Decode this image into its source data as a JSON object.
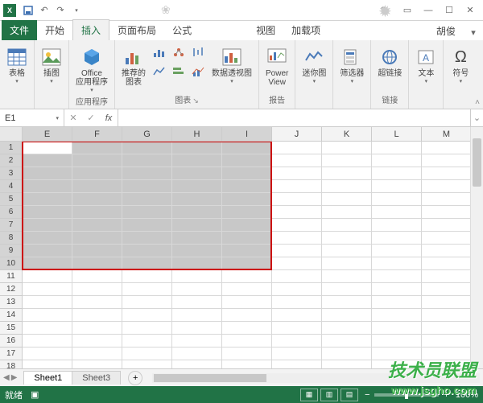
{
  "title_bar": {
    "qat": [
      "save",
      "undo",
      "redo"
    ]
  },
  "tabs": {
    "file": "文件",
    "items": [
      "开始",
      "插入",
      "页面布局",
      "公式",
      "视图",
      "加载项"
    ],
    "active_index": 1,
    "user": "胡俊"
  },
  "ribbon": {
    "groups": {
      "tables": {
        "btn": "表格",
        "label": ""
      },
      "illustrations": {
        "btn": "插图",
        "label": ""
      },
      "apps": {
        "btn": "Office\n应用程序",
        "label": "应用程序"
      },
      "charts": {
        "btn": "推荐的\n图表",
        "pivot": "数据透视图",
        "label": "图表"
      },
      "reports": {
        "btn": "Power\nView",
        "label": "报告"
      },
      "sparklines": {
        "btn": "迷你图",
        "label": ""
      },
      "filters": {
        "btn": "筛选器",
        "label": ""
      },
      "links": {
        "btn": "超链接",
        "label": "链接"
      },
      "text": {
        "btn": "文本",
        "label": ""
      },
      "symbols": {
        "btn": "符号",
        "label": ""
      }
    }
  },
  "formula_bar": {
    "name_box": "E1",
    "fx_label": "fx"
  },
  "grid": {
    "columns": [
      "E",
      "F",
      "G",
      "H",
      "I",
      "J",
      "K",
      "L",
      "M"
    ],
    "selected_cols": [
      0,
      1,
      2,
      3,
      4
    ],
    "row_count": 18,
    "selected_rows": [
      1,
      2,
      3,
      4,
      5,
      6,
      7,
      8,
      9,
      10
    ],
    "active_cell": {
      "row": 1,
      "col": 0
    }
  },
  "sheets": {
    "tabs": [
      "Sheet1",
      "Sheet3"
    ],
    "active": 0
  },
  "status": {
    "mode": "就绪",
    "zoom": "100%"
  },
  "watermark": {
    "text": "技术员联盟",
    "url": "www.jsgho.com"
  }
}
